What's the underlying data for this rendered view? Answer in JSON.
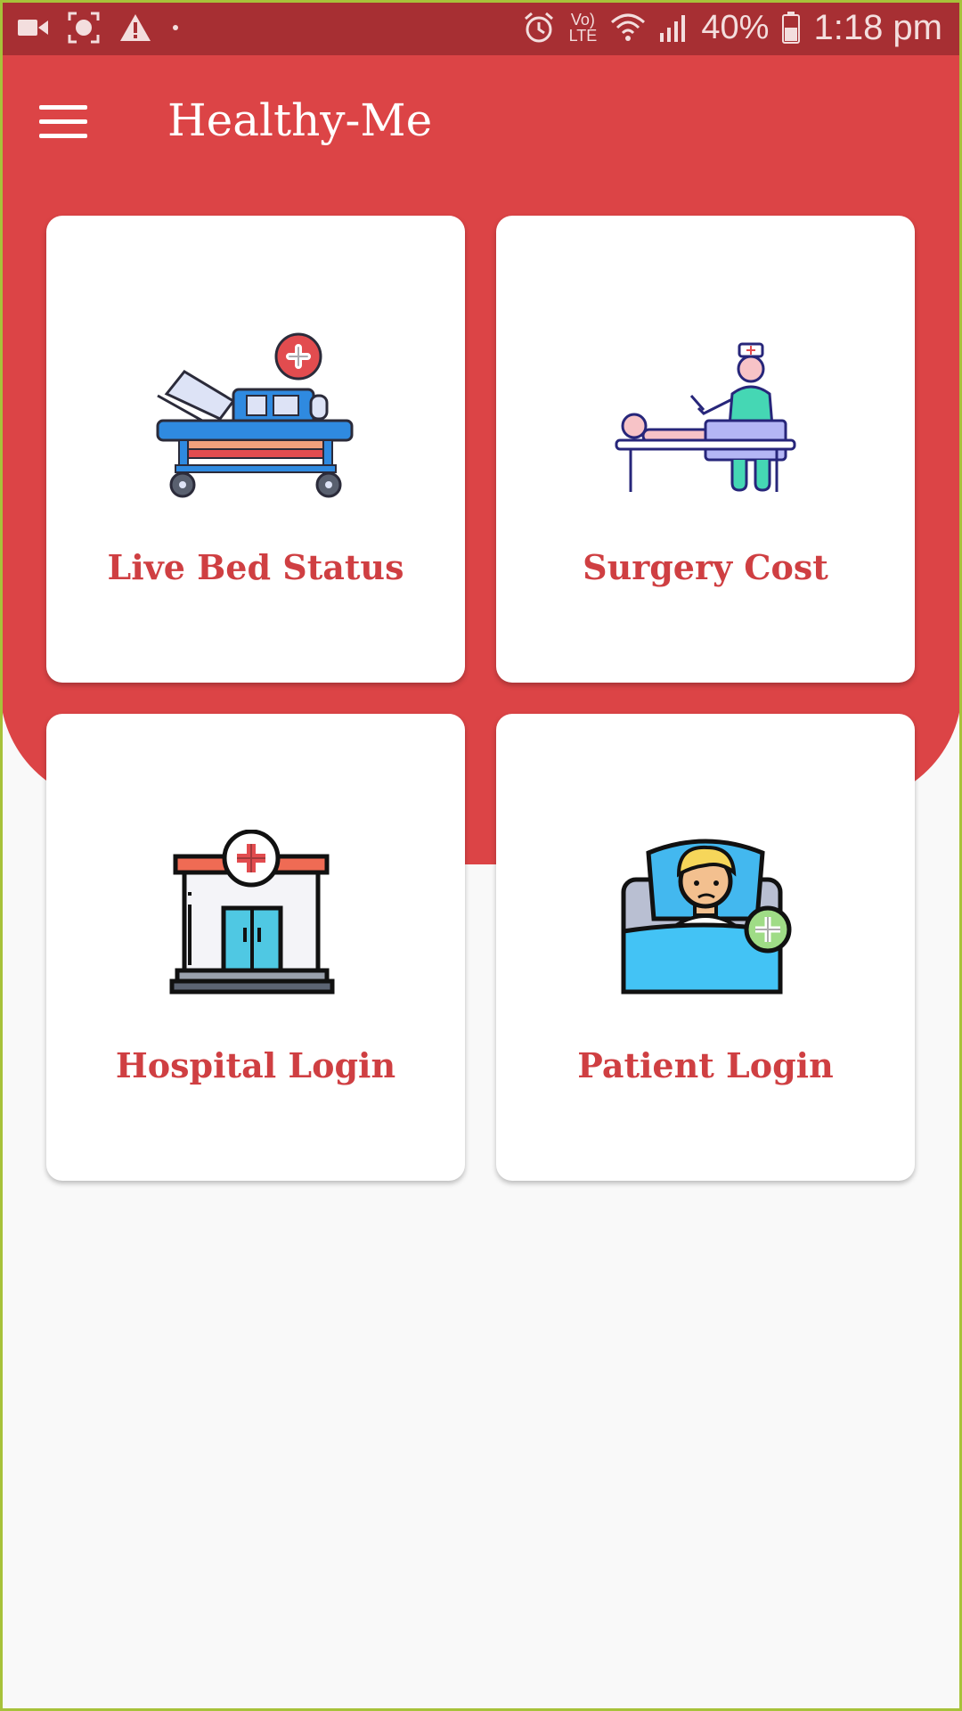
{
  "status_bar": {
    "battery": "40%",
    "time": "1:18 pm",
    "volte": "Vo) LTE",
    "left_icons": [
      "video-camera-icon",
      "screenshot-icon",
      "warning-icon",
      "dot-icon"
    ],
    "right_icons": [
      "alarm-icon",
      "volte-icon",
      "wifi-icon",
      "signal-icon",
      "battery-icon"
    ]
  },
  "app_bar": {
    "title": "Healthy-Me",
    "menu_icon": "menu-icon"
  },
  "colors": {
    "status_bar": "#a72f33",
    "primary": "#dc4446",
    "card_text": "#cf3f42",
    "background": "#f9f9f9"
  },
  "cards": [
    {
      "label": "Live Bed Status",
      "icon": "hospital-bed-icon"
    },
    {
      "label": "Surgery Cost",
      "icon": "surgery-icon"
    },
    {
      "label": "Hospital Login",
      "icon": "hospital-building-icon"
    },
    {
      "label": "Patient Login",
      "icon": "patient-in-bed-icon"
    }
  ]
}
